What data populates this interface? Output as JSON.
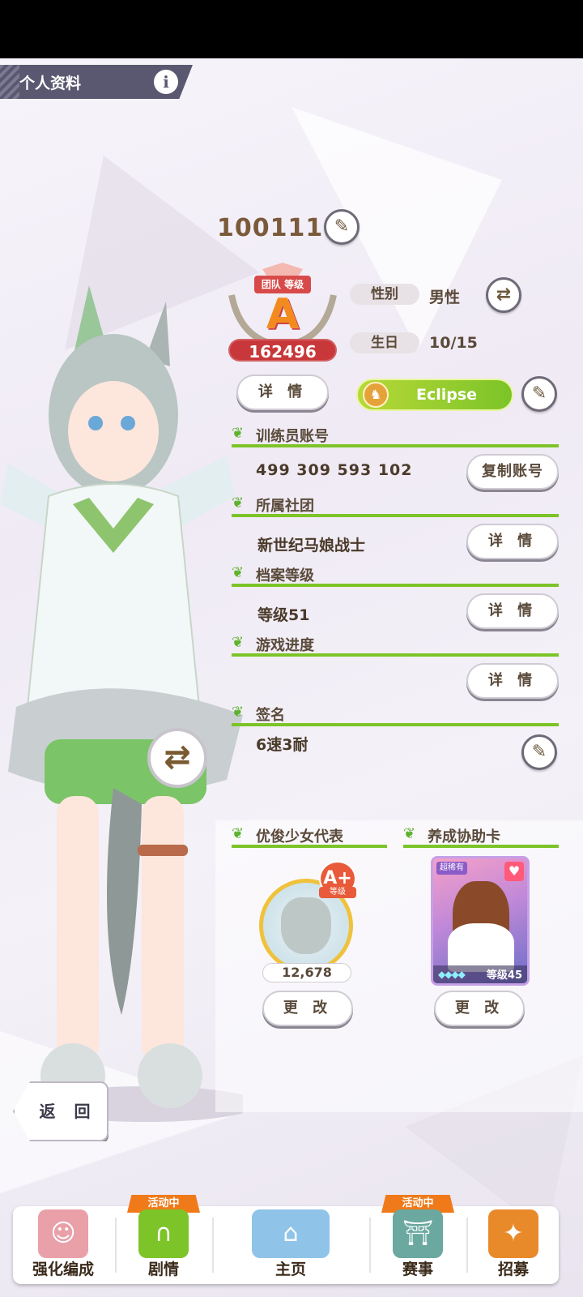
{
  "header": {
    "title": "个人资料",
    "info_icon": "i"
  },
  "profile": {
    "trainer_id": "100111",
    "team_rank_label": "团队 等级",
    "team_rank": "A",
    "team_rank_score": "162496",
    "gender_label": "性别",
    "gender_value": "男性",
    "birthday_label": "生日",
    "birthday_value": "10/15",
    "detail_label": "详 情",
    "title_name": "Eclipse"
  },
  "sections": {
    "trainer_account": {
      "label": "训练员账号",
      "value": "499 309 593 102",
      "button": "复制账号"
    },
    "club": {
      "label": "所属社团",
      "value": "新世纪马娘战士",
      "button": "详 情"
    },
    "archive_level": {
      "label": "档案等级",
      "value": "等级51",
      "button": "详 情"
    },
    "game_progress": {
      "label": "游戏进度",
      "value": "",
      "button": "详 情"
    },
    "signature": {
      "label": "签名",
      "value": "6速3耐"
    }
  },
  "showcase": {
    "representative_label": "优俊少女代表",
    "representative_rank": "A+",
    "representative_rank_sub": "等级",
    "representative_score": "12,678",
    "support_label": "养成协助卡",
    "support_rarity": "超稀有",
    "support_level": "等级45",
    "change_label": "更 改"
  },
  "back_label": "返 回",
  "nav": {
    "items": [
      {
        "label": "强化编成",
        "badge": ""
      },
      {
        "label": "剧情",
        "badge": "活动中"
      },
      {
        "label": "主页",
        "badge": ""
      },
      {
        "label": "赛事",
        "badge": "活动中"
      },
      {
        "label": "招募",
        "badge": ""
      }
    ]
  },
  "colors": {
    "accent_green": "#7cc428",
    "rank_red": "#c8383a",
    "header_bg": "#5a5870",
    "badge_orange": "#f07a1a"
  }
}
